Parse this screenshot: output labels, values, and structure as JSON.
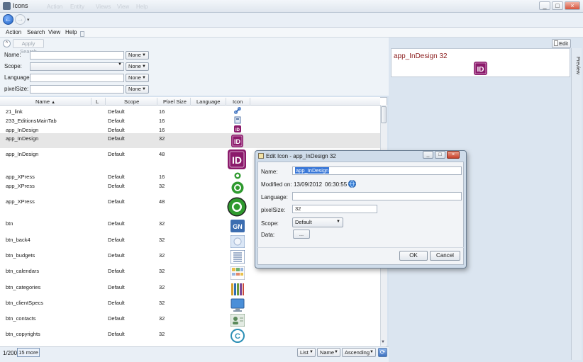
{
  "window": {
    "title": "Icons",
    "ghost_menu": [
      "Action",
      "Entity",
      "Views",
      "View",
      "Help"
    ],
    "controls": [
      "_",
      "□",
      "×"
    ]
  },
  "nav": {
    "back": "←",
    "forward": "→",
    "dropdown": "▾"
  },
  "menu": [
    "Action",
    "Search",
    "View",
    "Help"
  ],
  "search": {
    "apply_label": "Apply Search",
    "fields": [
      {
        "label": "Name:",
        "value": "",
        "mode": "None"
      },
      {
        "label": "Scope:",
        "value": "",
        "mode": "None"
      },
      {
        "label": "Language:",
        "value": "",
        "mode": "None"
      },
      {
        "label": "pixelSize:",
        "value": "",
        "mode": "None"
      }
    ]
  },
  "table": {
    "columns": [
      "Name",
      "L",
      "Scope",
      "Pixel Size",
      "Language",
      "Icon"
    ],
    "sort_indicator": "▲",
    "rows": [
      {
        "name": "21_link",
        "scope": "Default",
        "size": "16",
        "icon": "link-icon"
      },
      {
        "name": "233_EditionsMainTab",
        "scope": "Default",
        "size": "16",
        "icon": "editions-tab-icon"
      },
      {
        "name": "app_InDesign",
        "scope": "Default",
        "size": "16",
        "icon": "indesign-icon"
      },
      {
        "name": "app_InDesign",
        "scope": "Default",
        "size": "32",
        "icon": "indesign-icon"
      },
      {
        "name": "app_InDesign",
        "scope": "Default",
        "size": "48",
        "icon": "indesign-icon"
      },
      {
        "name": "app_XPress",
        "scope": "Default",
        "size": "16",
        "icon": "xpress-icon"
      },
      {
        "name": "app_XPress",
        "scope": "Default",
        "size": "32",
        "icon": "xpress-icon"
      },
      {
        "name": "app_XPress",
        "scope": "Default",
        "size": "48",
        "icon": "xpress-icon"
      },
      {
        "name": "btn",
        "scope": "Default",
        "size": "32",
        "icon": "gn-icon"
      },
      {
        "name": "btn_back4",
        "scope": "Default",
        "size": "32",
        "icon": "back-icon"
      },
      {
        "name": "btn_budgets",
        "scope": "Default",
        "size": "32",
        "icon": "budgets-icon"
      },
      {
        "name": "btn_calendars",
        "scope": "Default",
        "size": "32",
        "icon": "calendar-icon"
      },
      {
        "name": "btn_categories",
        "scope": "Default",
        "size": "32",
        "icon": "categories-icon"
      },
      {
        "name": "btn_clientSpecs",
        "scope": "Default",
        "size": "32",
        "icon": "monitor-icon"
      },
      {
        "name": "btn_contacts",
        "scope": "Default",
        "size": "32",
        "icon": "contacts-icon"
      },
      {
        "name": "btn_copyrights",
        "scope": "Default",
        "size": "32",
        "icon": "copyright-icon"
      }
    ]
  },
  "status": {
    "count": "1/200",
    "more": "15 more",
    "view": "List",
    "sort_field": "Name",
    "sort_order": "Ascending"
  },
  "preview": {
    "edit_label": "Edit",
    "title": "app_InDesign 32",
    "side_label": "Preview",
    "icon_text": "ID"
  },
  "dialog": {
    "title": "Edit Icon - app_InDesign 32",
    "name_label": "Name:",
    "name_value": "app_InDesign",
    "modified_label": "Modified on:",
    "modified_date": "13/09/2012",
    "modified_time": "06:30:55",
    "language_label": "Language:",
    "language_value": "",
    "pixelsize_label": "pixelSize:",
    "pixelsize_value": "32",
    "scope_label": "Scope:",
    "scope_value": "Default",
    "data_label": "Data:",
    "data_button": "...",
    "ok": "OK",
    "cancel": "Cancel"
  },
  "colors": {
    "indesign": "#8b1a6b",
    "xpress": "#2f9a2f",
    "selection": "#3a78d8",
    "dialog_frame": "#6a7d92"
  }
}
